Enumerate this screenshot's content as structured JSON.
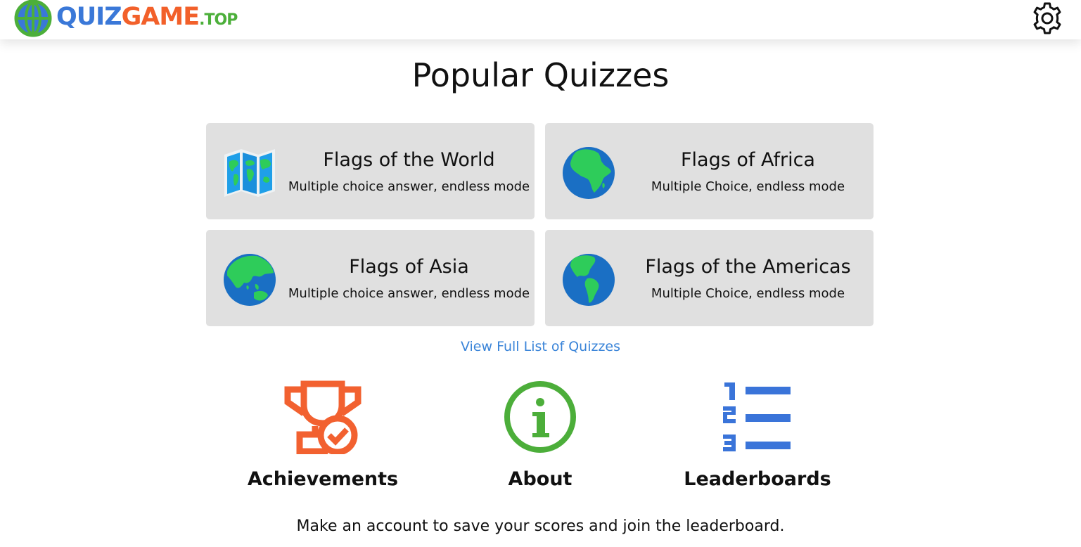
{
  "header": {
    "logo": {
      "part1": "QUIZ",
      "part2": "GAME",
      "part3": ".TOP",
      "icon": "globe-icon"
    },
    "settings_icon": "gear-icon"
  },
  "page_title": "Popular Quizzes",
  "quizzes": [
    {
      "title": "Flags of the World",
      "subtitle": "Multiple choice answer, endless mode",
      "icon": "world-map-icon"
    },
    {
      "title": "Flags of Africa",
      "subtitle": "Multiple Choice, endless mode",
      "icon": "globe-africa-icon"
    },
    {
      "title": "Flags of Asia",
      "subtitle": "Multiple choice answer, endless mode",
      "icon": "globe-asia-icon"
    },
    {
      "title": "Flags of the Americas",
      "subtitle": "Multiple Choice, endless mode",
      "icon": "globe-americas-icon"
    }
  ],
  "view_all_link": "View Full List of Quizzes",
  "features": [
    {
      "label": "Achievements",
      "icon": "trophy-icon",
      "color": "#f26130"
    },
    {
      "label": "About",
      "icon": "info-icon",
      "color": "#4cae3a"
    },
    {
      "label": "Leaderboards",
      "icon": "ranked-list-icon",
      "color": "#3a74d9"
    }
  ],
  "footer_text": "Make an account to save your scores and join the leaderboard.",
  "colors": {
    "card_background": "#e0e0e0",
    "link": "#3a84d8",
    "ocean": "#1a6fc4",
    "land": "#2ecc5a"
  }
}
